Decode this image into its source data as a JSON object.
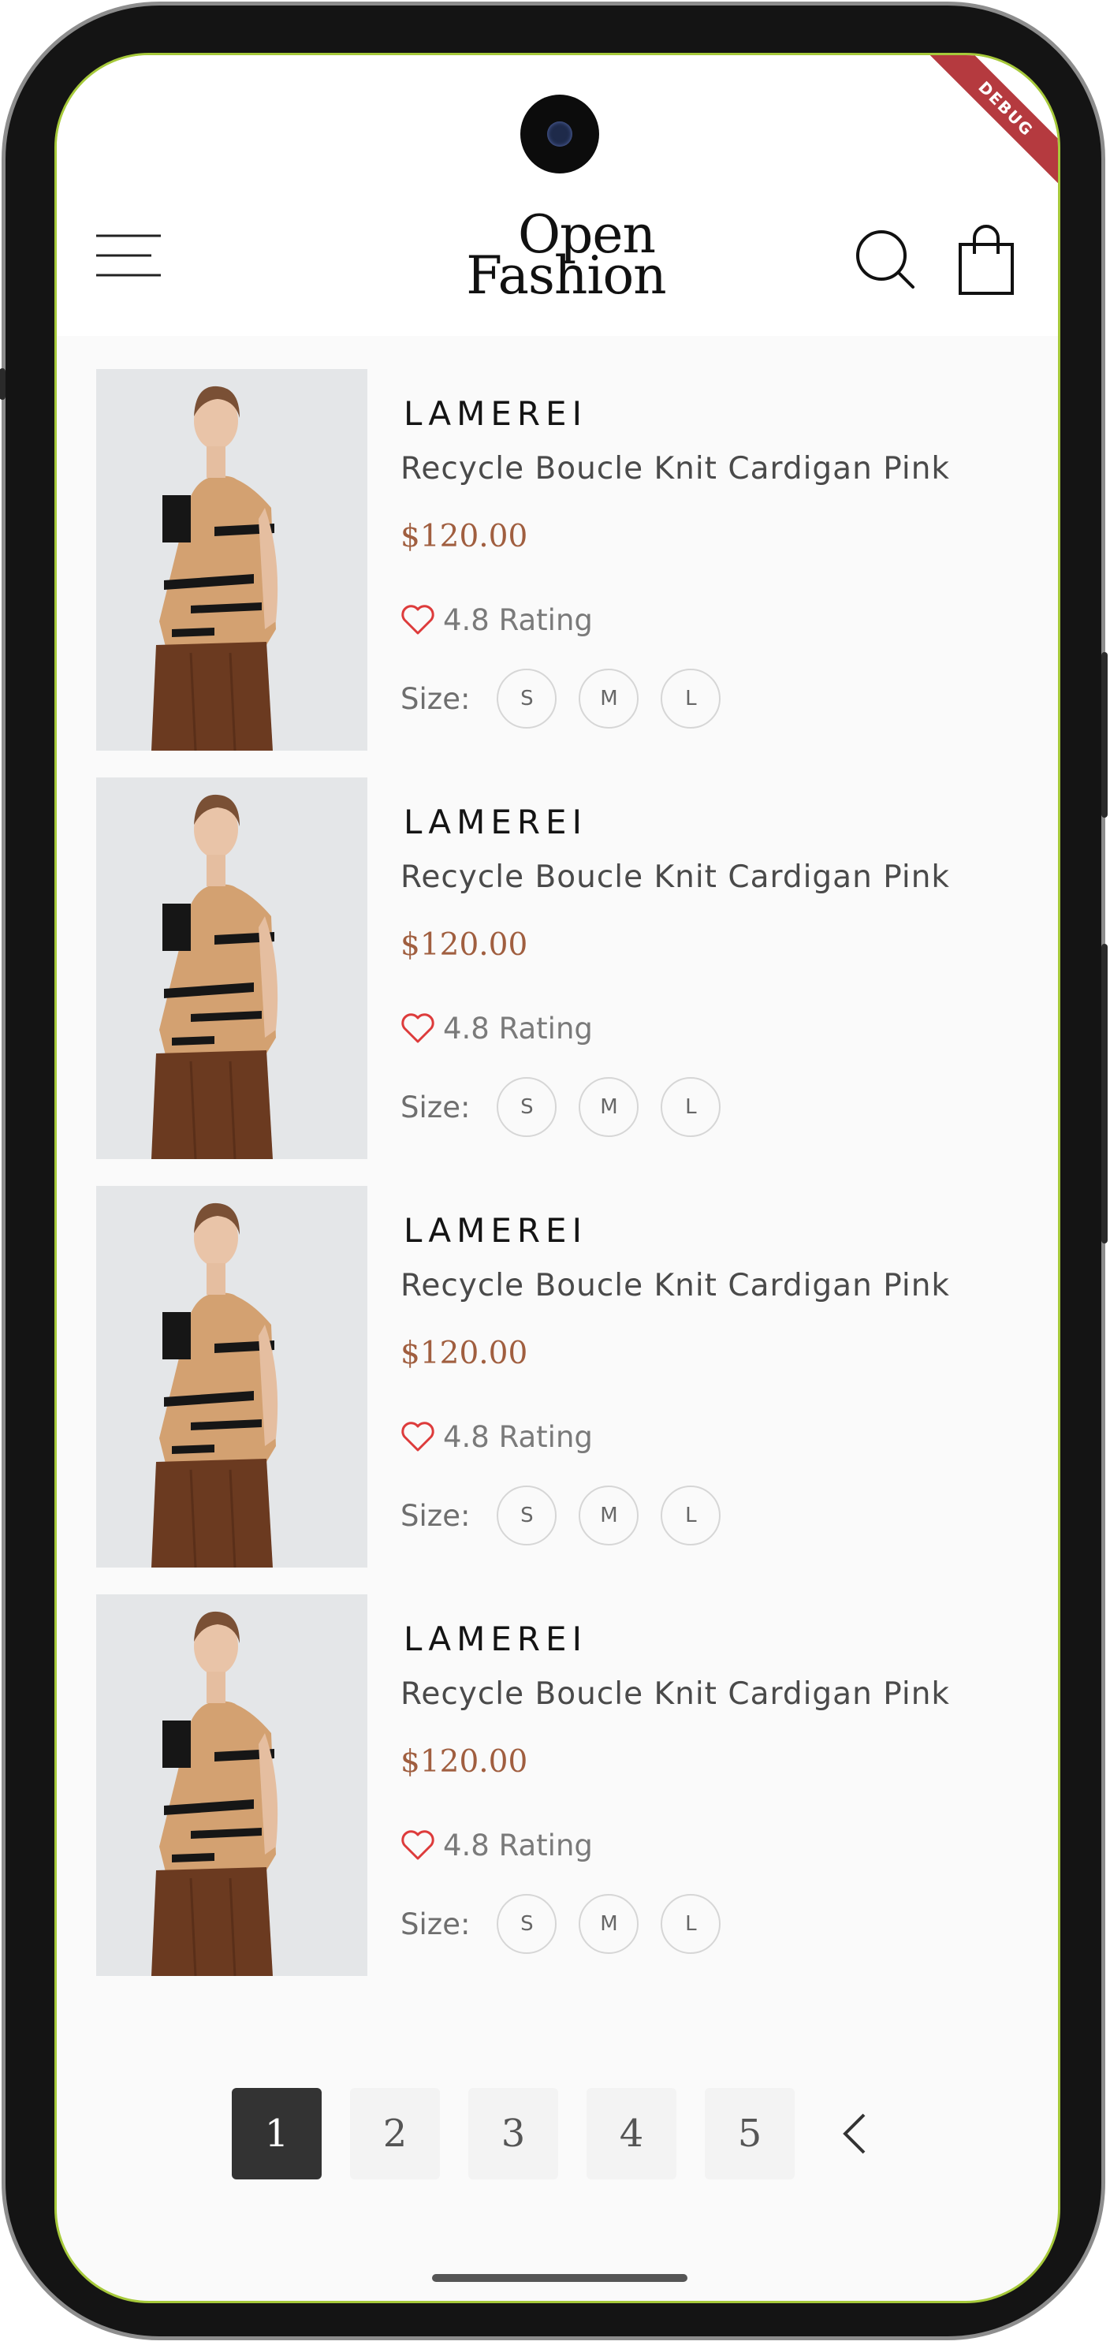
{
  "debug_banner": "DEBUG",
  "header": {
    "logo_line1": "Open",
    "logo_line2": "Fashion",
    "menu_icon": "hamburger-menu-icon",
    "search_icon": "search-icon",
    "bag_icon": "shopping-bag-icon"
  },
  "products": [
    {
      "brand": "LAMEREI",
      "name": "Recycle Boucle Knit Cardigan Pink",
      "price": "$120.00",
      "rating": "4.8 Rating",
      "size_label": "Size:",
      "sizes": [
        "S",
        "M",
        "L"
      ]
    },
    {
      "brand": "LAMEREI",
      "name": "Recycle Boucle Knit Cardigan Pink",
      "price": "$120.00",
      "rating": "4.8 Rating",
      "size_label": "Size:",
      "sizes": [
        "S",
        "M",
        "L"
      ]
    },
    {
      "brand": "LAMEREI",
      "name": "Recycle Boucle Knit Cardigan Pink",
      "price": "$120.00",
      "rating": "4.8 Rating",
      "size_label": "Size:",
      "sizes": [
        "S",
        "M",
        "L"
      ]
    },
    {
      "brand": "LAMEREI",
      "name": "Recycle Boucle Knit Cardigan Pink",
      "price": "$120.00",
      "rating": "4.8 Rating",
      "size_label": "Size:",
      "sizes": [
        "S",
        "M",
        "L"
      ]
    }
  ],
  "pagination": {
    "pages": [
      "1",
      "2",
      "3",
      "4",
      "5"
    ],
    "active_page": "1",
    "prev_icon": "chevron-left-icon"
  },
  "colors": {
    "price": "#a05e3f",
    "heart": "#dd3b3b",
    "active_page_bg": "#333333"
  }
}
